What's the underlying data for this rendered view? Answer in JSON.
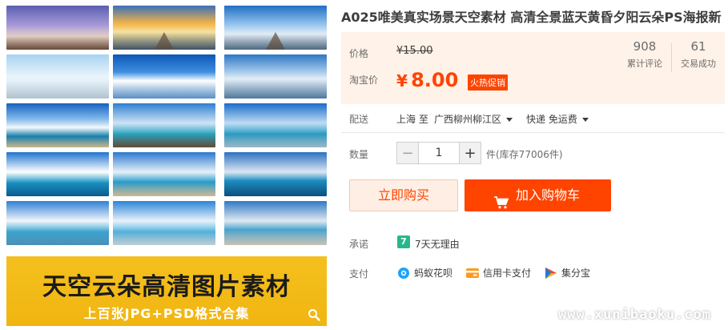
{
  "product": {
    "title": "A025唯美真实场景天空素材 高清全景蓝天黄昏夕阳云朵PS海报新"
  },
  "gallery": {
    "banner_title": "天空云朵高清图片素材",
    "banner_subtitle": "上百张JPG+PSD格式合集"
  },
  "pricing": {
    "price_label": "价格",
    "original_price": "¥15.00",
    "taobao_price_label": "淘宝价",
    "currency_symbol": "¥",
    "current_price": "8.00",
    "promo_badge": "火热促销",
    "reviews_count": "908",
    "reviews_label": "累计评论",
    "sales_count": "61",
    "sales_label": "交易成功"
  },
  "delivery": {
    "label": "配送",
    "from": "上海 至",
    "destination": "广西柳州柳江区",
    "shipping": "快递 免运费"
  },
  "quantity": {
    "label": "数量",
    "minus": "−",
    "value": "1",
    "plus": "+",
    "stock_text": "件(库存77006件)"
  },
  "actions": {
    "buy_now": "立即购买",
    "add_to_cart": "加入购物车"
  },
  "promise": {
    "label": "承诺",
    "badge": "7",
    "text": "7天无理由"
  },
  "payment": {
    "label": "支付",
    "methods": [
      "蚂蚁花呗",
      "信用卡支付",
      "集分宝"
    ]
  },
  "watermark": "www.xunibaoku.com",
  "colors": {
    "accent": "#ff4400",
    "price_panel_bg": "#fff2e8",
    "banner_yellow": "#f4c01e",
    "promise_green": "#28b78d"
  }
}
